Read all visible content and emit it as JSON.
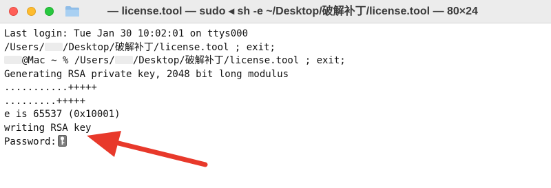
{
  "window": {
    "title": "— license.tool — sudo ◂ sh -e ~/Desktop/破解补丁/license.tool — 80×24"
  },
  "terminal": {
    "last_login": "Last login: Tue Jan 30 10:02:01 on ttys000",
    "cmd_path_prefix": "/Users/",
    "cmd_path_suffix": "/Desktop/破解补丁/license.tool ; exit;",
    "prompt_suffix": "@Mac ~ % /Users/",
    "prompt_path_suffix": "/Desktop/破解补丁/license.tool ; exit;",
    "output_lines": [
      "Generating RSA private key, 2048 bit long modulus",
      "...........+++++",
      ".........+++++",
      "e is 65537 (0x10001)",
      "writing RSA key"
    ],
    "password_prompt": "Password:"
  },
  "colors": {
    "titlebar": "#ececec",
    "close": "#ff5f57",
    "minimize": "#febc2e",
    "zoom": "#28c840",
    "arrow": "#e8392b"
  }
}
